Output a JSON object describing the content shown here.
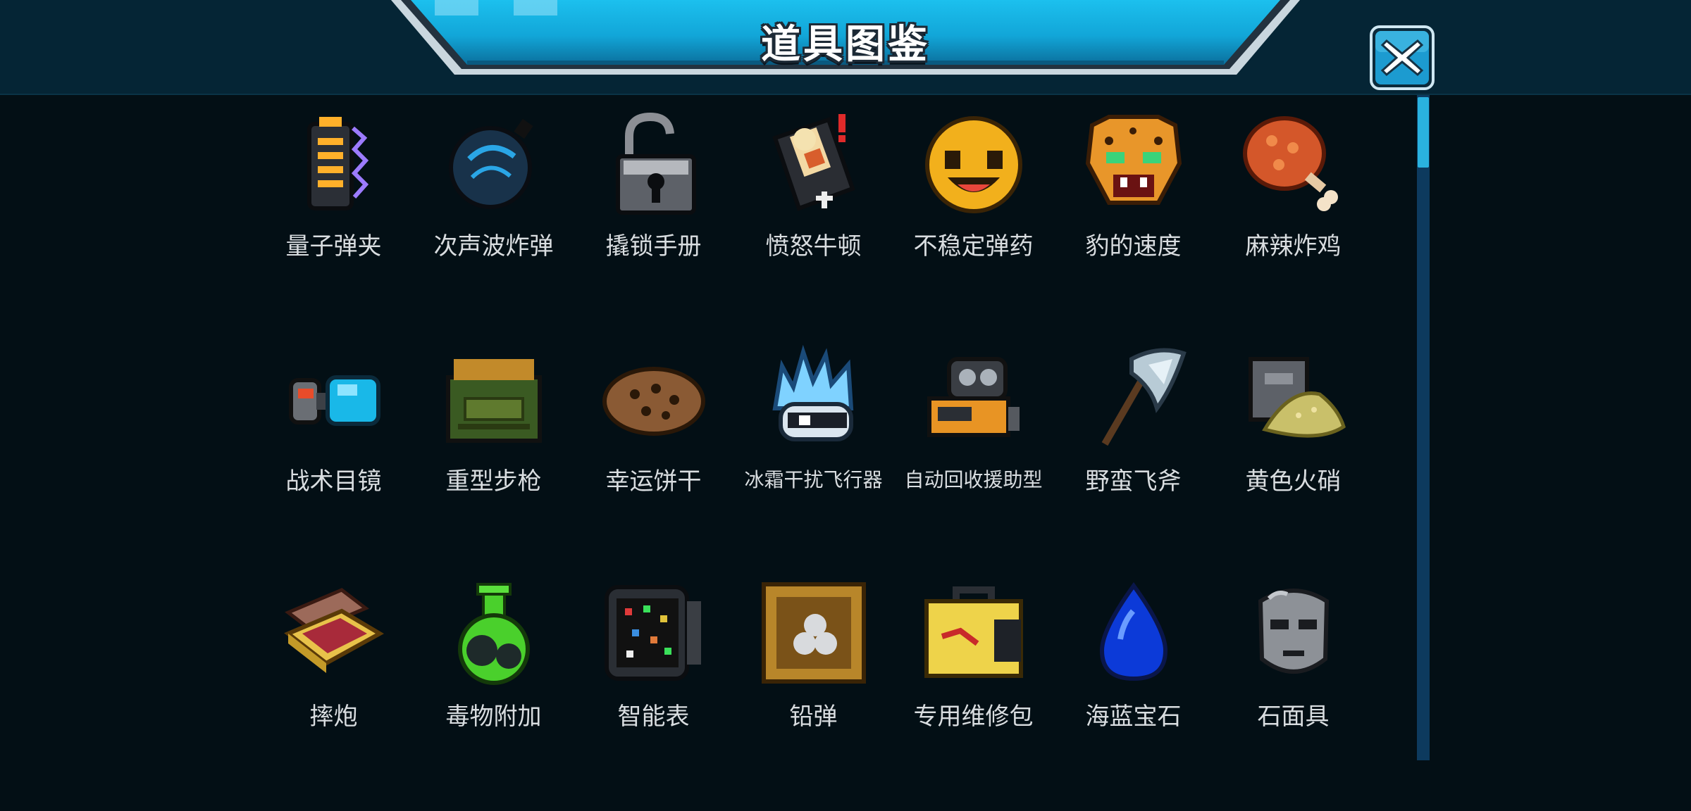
{
  "header": {
    "title": "道具图鉴",
    "close_icon": "close-x-icon"
  },
  "colors": {
    "background": "#030f15",
    "header_bar": "#052535",
    "banner_blue": "#19b6e8",
    "scroll_thumb": "#2ab2df",
    "label_text": "#d9dde0"
  },
  "items": [
    {
      "name": "量子弹夹",
      "icon": "battery-clip-icon"
    },
    {
      "name": "次声波炸弹",
      "icon": "sonic-bomb-icon"
    },
    {
      "name": "撬锁手册",
      "icon": "padlock-icon"
    },
    {
      "name": "愤怒牛顿",
      "icon": "angry-newton-icon"
    },
    {
      "name": "不稳定弹药",
      "icon": "smiley-ball-icon"
    },
    {
      "name": "豹的速度",
      "icon": "leopard-head-icon"
    },
    {
      "name": "麻辣炸鸡",
      "icon": "fried-chicken-icon"
    },
    {
      "name": "战术目镜",
      "icon": "goggles-icon"
    },
    {
      "name": "重型步枪",
      "icon": "ammo-crate-icon"
    },
    {
      "name": "幸运饼干",
      "icon": "cookie-icon"
    },
    {
      "name": "冰霜干扰飞行器",
      "icon": "frost-drone-icon"
    },
    {
      "name": "自动回收援助型",
      "icon": "recycle-robot-icon"
    },
    {
      "name": "野蛮飞斧",
      "icon": "axe-icon"
    },
    {
      "name": "黄色火硝",
      "icon": "tnt-powder-icon"
    },
    {
      "name": "摔炮",
      "icon": "snap-box-icon"
    },
    {
      "name": "毒物附加",
      "icon": "poison-flask-icon"
    },
    {
      "name": "智能表",
      "icon": "smart-watch-icon"
    },
    {
      "name": "铅弹",
      "icon": "lead-shot-cabinet-icon"
    },
    {
      "name": "专用维修包",
      "icon": "repair-kit-icon"
    },
    {
      "name": "海蓝宝石",
      "icon": "blue-gem-icon"
    },
    {
      "name": "石面具",
      "icon": "stone-mask-icon"
    }
  ]
}
